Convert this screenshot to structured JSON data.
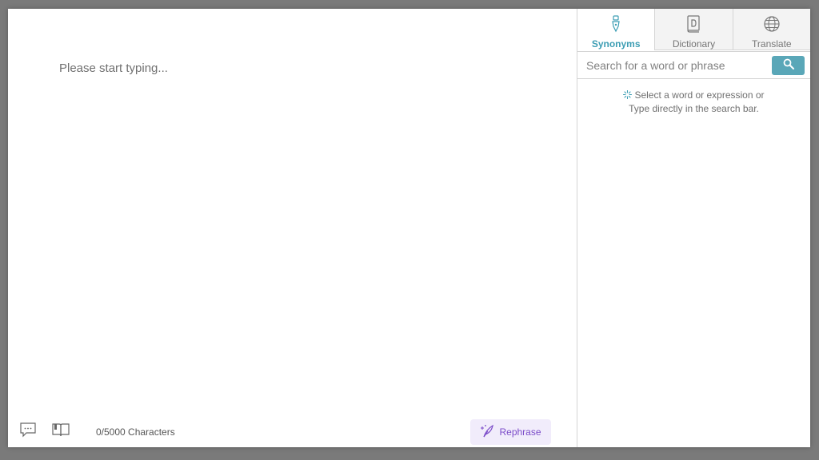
{
  "editor": {
    "placeholder": "Please start typing...",
    "char_count": "0/5000 Characters",
    "rephrase_label": "Rephrase"
  },
  "sidebar": {
    "tabs": [
      {
        "label": "Synonyms",
        "icon": "pen-nib-icon",
        "active": true
      },
      {
        "label": "Dictionary",
        "icon": "dictionary-book-icon",
        "active": false
      },
      {
        "label": "Translate",
        "icon": "globe-icon",
        "active": false
      }
    ],
    "search": {
      "placeholder": "Search for a word or phrase",
      "value": ""
    },
    "hint_line1": "Select a word or expression or",
    "hint_line2": "Type directly in the search bar."
  },
  "colors": {
    "accent": "#3c9db3",
    "search_button": "#5aa7b8",
    "rephrase_bg": "#f1ecfb",
    "rephrase_text": "#7b4bc9"
  }
}
